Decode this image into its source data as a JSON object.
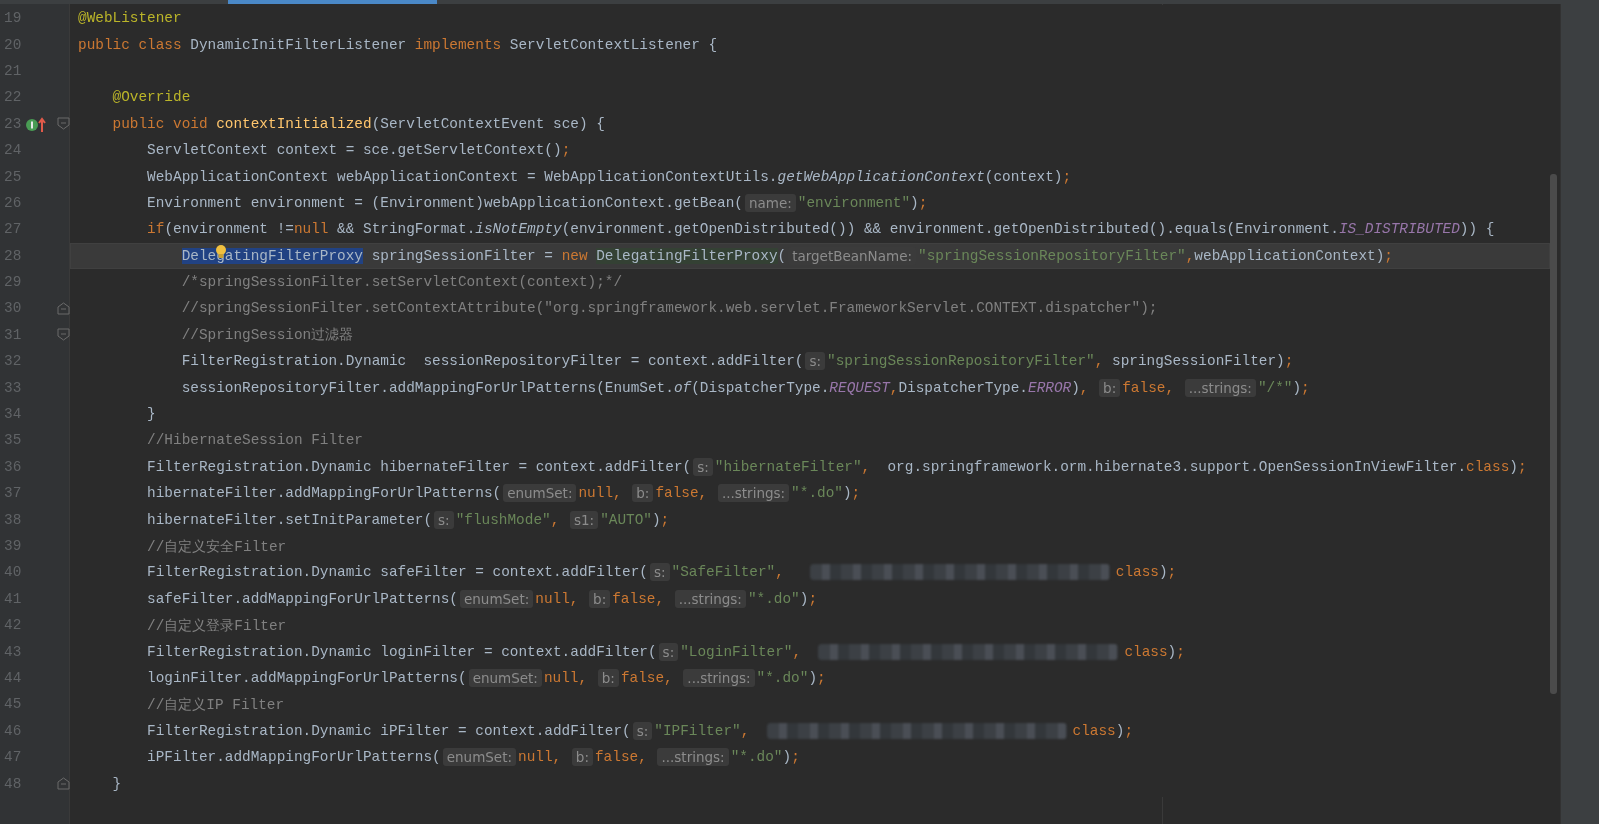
{
  "editor": {
    "lines": [
      {
        "number": "19",
        "current": false,
        "tokens": [
          {
            "kind": "annotation",
            "text": "@WebListener"
          }
        ]
      },
      {
        "number": "20",
        "current": false,
        "tokens": [
          {
            "kind": "keyword",
            "text": "public class "
          },
          {
            "kind": "plain",
            "text": "DynamicInitFilterListener "
          },
          {
            "kind": "keyword",
            "text": "implements "
          },
          {
            "kind": "plain",
            "text": "ServletContextListener {"
          }
        ]
      },
      {
        "number": "21",
        "current": false
      },
      {
        "number": "22",
        "current": false,
        "tokens": [
          {
            "kind": "annotation",
            "text": "    @Override"
          }
        ]
      },
      {
        "number": "23",
        "current": false,
        "gutter_marker": {
          "kind": "implements"
        },
        "fold_marker": {
          "kind": "open"
        },
        "tokens": [
          {
            "kind": "keyword",
            "text": "    public void "
          },
          {
            "kind": "declaration",
            "text": "contextInitialized"
          },
          {
            "kind": "plain",
            "text": "(ServletContextEvent sce) {"
          }
        ]
      },
      {
        "number": "24",
        "current": false,
        "tokens": [
          {
            "kind": "plain",
            "text": "        ServletContext context = sce.getServletContext()"
          },
          {
            "kind": "punct",
            "text": ";"
          }
        ]
      },
      {
        "number": "25",
        "current": false,
        "tokens": [
          {
            "kind": "plain",
            "text": "        WebApplicationContext webApplicationContext = WebApplicationContextUtils."
          },
          {
            "kind": "static",
            "text": "getWebApplicationContext"
          },
          {
            "kind": "plain",
            "text": "(context)"
          },
          {
            "kind": "punct",
            "text": ";"
          }
        ]
      },
      {
        "number": "26",
        "current": false,
        "tokens": [
          {
            "kind": "plain",
            "text": "        Environment environment = (Environment)webApplicationContext.getBean("
          },
          {
            "kind": "hint",
            "text": "name:"
          },
          {
            "kind": "string",
            "text": "\"environment\""
          },
          {
            "kind": "plain",
            "text": ")"
          },
          {
            "kind": "punct",
            "text": ";"
          }
        ]
      },
      {
        "number": "27",
        "current": false,
        "tokens": [
          {
            "kind": "keyword",
            "text": "        if"
          },
          {
            "kind": "plain",
            "text": "(environment !="
          },
          {
            "kind": "keyword",
            "text": "null "
          },
          {
            "kind": "plain",
            "text": "&& StringFormat."
          },
          {
            "kind": "static",
            "text": "isNotEmpty"
          },
          {
            "kind": "plain",
            "text": "(environment.getOpenDistributed()) && environment.getOpenDistributed().equals(Environment."
          },
          {
            "kind": "constant",
            "text": "IS_DISTRIBUTED"
          },
          {
            "kind": "plain",
            "text": ")) {"
          }
        ]
      },
      {
        "number": "28",
        "current": true,
        "bulb": true,
        "tokens": [
          {
            "kind": "selected",
            "text": "            DelegatingFilterProxy"
          },
          {
            "kind": "plain",
            "text": " springSessionFilter = "
          },
          {
            "kind": "keyword",
            "text": "new "
          },
          {
            "kind": "usage",
            "text": "DelegatingFilterProxy"
          },
          {
            "kind": "plain",
            "text": "("
          },
          {
            "kind": "hint",
            "text": "targetBeanName:"
          },
          {
            "kind": "string",
            "text": "\"springSessionRepositoryFilter\""
          },
          {
            "kind": "punct",
            "text": ","
          },
          {
            "kind": "plain",
            "text": "webApplicationContext)"
          },
          {
            "kind": "punct",
            "text": ";"
          }
        ]
      },
      {
        "number": "29",
        "current": false,
        "tokens": [
          {
            "kind": "comment",
            "text": "            /*springSessionFilter.setServletContext(context);*/"
          }
        ]
      },
      {
        "number": "30",
        "current": false,
        "fold_marker": {
          "kind": "close"
        },
        "tokens": [
          {
            "kind": "comment",
            "text": "            //springSessionFilter.setContextAttribute(\"org.springframework.web.servlet.FrameworkServlet.CONTEXT.dispatcher\");"
          }
        ]
      },
      {
        "number": "31",
        "current": false,
        "fold_marker": {
          "kind": "open"
        },
        "tokens": [
          {
            "kind": "comment",
            "text": "            //SpringSession过滤器"
          }
        ]
      },
      {
        "number": "32",
        "current": false,
        "tokens": [
          {
            "kind": "plain",
            "text": "            FilterRegistration.Dynamic  sessionRepositoryFilter = context.addFilter("
          },
          {
            "kind": "hint",
            "text": "s:"
          },
          {
            "kind": "string",
            "text": "\"springSessionRepositoryFilter\""
          },
          {
            "kind": "punct",
            "text": ", "
          },
          {
            "kind": "plain",
            "text": "springSessionFilter)"
          },
          {
            "kind": "punct",
            "text": ";"
          }
        ]
      },
      {
        "number": "33",
        "current": false,
        "tokens": [
          {
            "kind": "plain",
            "text": "            sessionRepositoryFilter.addMappingForUrlPatterns(EnumSet."
          },
          {
            "kind": "static",
            "text": "of"
          },
          {
            "kind": "plain",
            "text": "(DispatcherType."
          },
          {
            "kind": "constant",
            "text": "REQUEST"
          },
          {
            "kind": "punct",
            "text": ","
          },
          {
            "kind": "plain",
            "text": "DispatcherType."
          },
          {
            "kind": "constant",
            "text": "ERROR"
          },
          {
            "kind": "plain",
            "text": ")"
          },
          {
            "kind": "punct",
            "text": ", "
          },
          {
            "kind": "hint",
            "text": "b:"
          },
          {
            "kind": "keyword",
            "text": "false"
          },
          {
            "kind": "punct",
            "text": ", "
          },
          {
            "kind": "hint",
            "text": "...strings:"
          },
          {
            "kind": "string",
            "text": "\"/*\""
          },
          {
            "kind": "plain",
            "text": ")"
          },
          {
            "kind": "punct",
            "text": ";"
          }
        ]
      },
      {
        "number": "34",
        "current": false,
        "tokens": [
          {
            "kind": "plain",
            "text": "        }"
          }
        ]
      },
      {
        "number": "35",
        "current": false,
        "tokens": [
          {
            "kind": "comment",
            "text": "        //HibernateSession Filter"
          }
        ]
      },
      {
        "number": "36",
        "current": false,
        "tokens": [
          {
            "kind": "plain",
            "text": "        FilterRegistration.Dynamic hibernateFilter = context.addFilter("
          },
          {
            "kind": "hint",
            "text": "s:"
          },
          {
            "kind": "string",
            "text": "\"hibernateFilter\""
          },
          {
            "kind": "punct",
            "text": ",  "
          },
          {
            "kind": "plain",
            "text": "org.springframework.orm.hibernate3.support.OpenSessionInViewFilter."
          },
          {
            "kind": "keyword",
            "text": "class"
          },
          {
            "kind": "plain",
            "text": ")"
          },
          {
            "kind": "punct",
            "text": ";"
          }
        ]
      },
      {
        "number": "37",
        "current": false,
        "tokens": [
          {
            "kind": "plain",
            "text": "        hibernateFilter.addMappingForUrlPatterns("
          },
          {
            "kind": "hint",
            "text": "enumSet:"
          },
          {
            "kind": "keyword",
            "text": "null"
          },
          {
            "kind": "punct",
            "text": ", "
          },
          {
            "kind": "hint",
            "text": "b:"
          },
          {
            "kind": "keyword",
            "text": "false"
          },
          {
            "kind": "punct",
            "text": ", "
          },
          {
            "kind": "hint",
            "text": "...strings:"
          },
          {
            "kind": "string",
            "text": "\"*.do\""
          },
          {
            "kind": "plain",
            "text": ")"
          },
          {
            "kind": "punct",
            "text": ";"
          }
        ]
      },
      {
        "number": "38",
        "current": false,
        "tokens": [
          {
            "kind": "plain",
            "text": "        hibernateFilter.setInitParameter("
          },
          {
            "kind": "hint",
            "text": "s:"
          },
          {
            "kind": "string",
            "text": "\"flushMode\""
          },
          {
            "kind": "punct",
            "text": ", "
          },
          {
            "kind": "hint",
            "text": "s1:"
          },
          {
            "kind": "string",
            "text": "\"AUTO\""
          },
          {
            "kind": "plain",
            "text": ")"
          },
          {
            "kind": "punct",
            "text": ";"
          }
        ]
      },
      {
        "number": "39",
        "current": false,
        "tokens": [
          {
            "kind": "comment",
            "text": "        //自定义安全Filter"
          }
        ]
      },
      {
        "number": "40",
        "current": false,
        "tokens": [
          {
            "kind": "plain",
            "text": "        FilterRegistration.Dynamic safeFilter = context.addFilter("
          },
          {
            "kind": "hint",
            "text": "s:"
          },
          {
            "kind": "string",
            "text": "\"SafeFilter\""
          },
          {
            "kind": "punct",
            "text": ",   "
          },
          {
            "kind": "redacted"
          },
          {
            "kind": "keyword",
            "text": "class"
          },
          {
            "kind": "plain",
            "text": ")"
          },
          {
            "kind": "punct",
            "text": ";"
          }
        ]
      },
      {
        "number": "41",
        "current": false,
        "tokens": [
          {
            "kind": "plain",
            "text": "        safeFilter.addMappingForUrlPatterns("
          },
          {
            "kind": "hint",
            "text": "enumSet:"
          },
          {
            "kind": "keyword",
            "text": "null"
          },
          {
            "kind": "punct",
            "text": ", "
          },
          {
            "kind": "hint",
            "text": "b:"
          },
          {
            "kind": "keyword",
            "text": "false"
          },
          {
            "kind": "punct",
            "text": ", "
          },
          {
            "kind": "hint",
            "text": "...strings:"
          },
          {
            "kind": "string",
            "text": "\"*.do\""
          },
          {
            "kind": "plain",
            "text": ")"
          },
          {
            "kind": "punct",
            "text": ";"
          }
        ]
      },
      {
        "number": "42",
        "current": false,
        "tokens": [
          {
            "kind": "comment",
            "text": "        //自定义登录Filter"
          }
        ]
      },
      {
        "number": "43",
        "current": false,
        "tokens": [
          {
            "kind": "plain",
            "text": "        FilterRegistration.Dynamic loginFilter = context.addFilter("
          },
          {
            "kind": "hint",
            "text": "s:"
          },
          {
            "kind": "string",
            "text": "\"LoginFilter\""
          },
          {
            "kind": "punct",
            "text": ",  "
          },
          {
            "kind": "redacted"
          },
          {
            "kind": "keyword",
            "text": "class"
          },
          {
            "kind": "plain",
            "text": ")"
          },
          {
            "kind": "punct",
            "text": ";"
          }
        ]
      },
      {
        "number": "44",
        "current": false,
        "tokens": [
          {
            "kind": "plain",
            "text": "        loginFilter.addMappingForUrlPatterns("
          },
          {
            "kind": "hint",
            "text": "enumSet:"
          },
          {
            "kind": "keyword",
            "text": "null"
          },
          {
            "kind": "punct",
            "text": ", "
          },
          {
            "kind": "hint",
            "text": "b:"
          },
          {
            "kind": "keyword",
            "text": "false"
          },
          {
            "kind": "punct",
            "text": ", "
          },
          {
            "kind": "hint",
            "text": "...strings:"
          },
          {
            "kind": "string",
            "text": "\"*.do\""
          },
          {
            "kind": "plain",
            "text": ")"
          },
          {
            "kind": "punct",
            "text": ";"
          }
        ]
      },
      {
        "number": "45",
        "current": false,
        "tokens": [
          {
            "kind": "comment",
            "text": "        //自定义IP Filter"
          }
        ]
      },
      {
        "number": "46",
        "current": false,
        "tokens": [
          {
            "kind": "plain",
            "text": "        FilterRegistration.Dynamic iPFilter = context.addFilter("
          },
          {
            "kind": "hint",
            "text": "s:"
          },
          {
            "kind": "string",
            "text": "\"IPFilter\""
          },
          {
            "kind": "punct",
            "text": ",  "
          },
          {
            "kind": "redacted"
          },
          {
            "kind": "keyword",
            "text": "class"
          },
          {
            "kind": "plain",
            "text": ")"
          },
          {
            "kind": "punct",
            "text": ";"
          }
        ]
      },
      {
        "number": "47",
        "current": false,
        "tokens": [
          {
            "kind": "plain",
            "text": "        iPFilter.addMappingForUrlPatterns("
          },
          {
            "kind": "hint",
            "text": "enumSet:"
          },
          {
            "kind": "keyword",
            "text": "null"
          },
          {
            "kind": "punct",
            "text": ", "
          },
          {
            "kind": "hint",
            "text": "b:"
          },
          {
            "kind": "keyword",
            "text": "false"
          },
          {
            "kind": "punct",
            "text": ", "
          },
          {
            "kind": "hint",
            "text": "...strings:"
          },
          {
            "kind": "string",
            "text": "\"*.do\""
          },
          {
            "kind": "plain",
            "text": ")"
          },
          {
            "kind": "punct",
            "text": ";"
          }
        ]
      },
      {
        "number": "48",
        "current": false,
        "fold_marker": {
          "kind": "close"
        },
        "tokens": [
          {
            "kind": "plain",
            "text": "    }"
          }
        ]
      }
    ]
  }
}
